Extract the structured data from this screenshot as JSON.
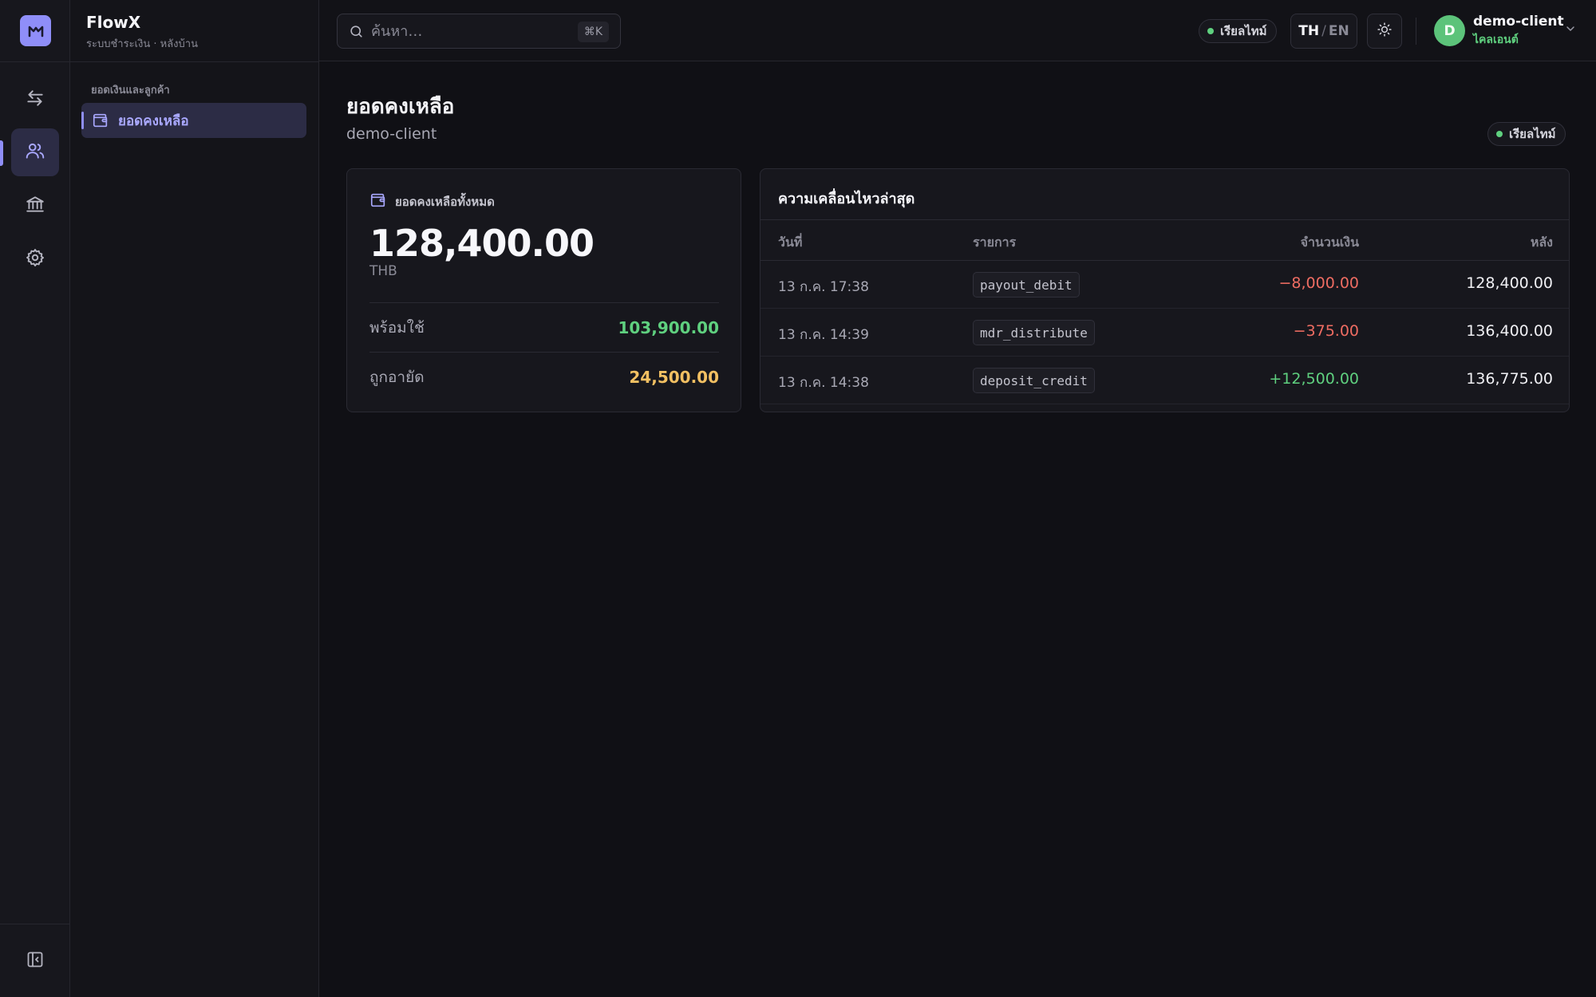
{
  "app": {
    "name": "FlowX",
    "subtitle": "ระบบชำระเงิน · หลังบ้าน",
    "accent": "#8f8ef8"
  },
  "rail": {
    "items": [
      {
        "icon": "transfer-arrows-icon",
        "active": false
      },
      {
        "icon": "users-icon",
        "active": true
      },
      {
        "icon": "bank-icon",
        "active": false
      },
      {
        "icon": "gear-icon",
        "active": false
      }
    ],
    "bottom_icon": "collapse-sidebar-icon"
  },
  "sidebar": {
    "section_label": "ยอดเงินและลูกค้า",
    "items": [
      {
        "label": "ยอดคงเหลือ",
        "icon": "wallet-icon",
        "active": true
      }
    ]
  },
  "topbar": {
    "search_placeholder": "ค้นหา…",
    "search_shortcut": "⌘K",
    "live_label": "เรียลไทม์",
    "lang_active": "TH",
    "lang_sep": "/",
    "lang_other": "EN",
    "theme_icon": "sun-icon",
    "user": {
      "initial": "D",
      "name": "demo-client",
      "role": "ไคลเอนต์"
    }
  },
  "page": {
    "title": "ยอดคงเหลือ",
    "subtitle": "demo-client",
    "live_label": "เรียลไทม์"
  },
  "balance": {
    "label": "ยอดคงเหลือทั้งหมด",
    "total": "128,400.00",
    "currency": "THB",
    "available_label": "พร้อมใช้",
    "available": "103,900.00",
    "frozen_label": "ถูกอายัด",
    "frozen": "24,500.00"
  },
  "activity": {
    "title": "ความเคลื่อนไหวล่าสุด",
    "columns": [
      "วันที่",
      "รายการ",
      "จำนวนเงิน",
      "หลัง"
    ],
    "rows": [
      {
        "date": "13 ก.ค. 17:38",
        "type": "payout_debit",
        "amount": "−8,000.00",
        "direction": "negative",
        "after": "128,400.00"
      },
      {
        "date": "13 ก.ค. 14:39",
        "type": "mdr_distribute",
        "amount": "−375.00",
        "direction": "negative",
        "after": "136,400.00"
      },
      {
        "date": "13 ก.ค. 14:38",
        "type": "deposit_credit",
        "amount": "+12,500.00",
        "direction": "positive",
        "after": "136,775.00"
      }
    ]
  }
}
